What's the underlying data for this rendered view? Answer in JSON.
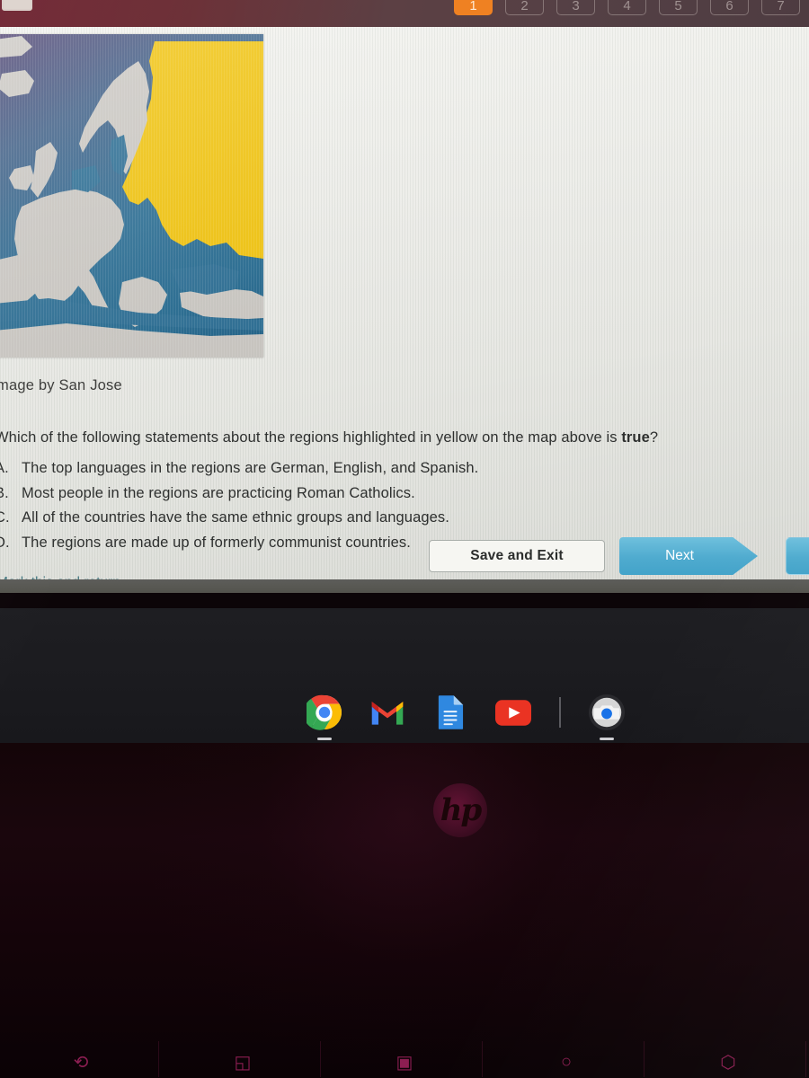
{
  "quiz_nav": {
    "buttons": [
      {
        "label": "1",
        "active": true
      },
      {
        "label": "2",
        "active": false
      },
      {
        "label": "3",
        "active": false
      },
      {
        "label": "4",
        "active": false
      },
      {
        "label": "5",
        "active": false
      },
      {
        "label": "6",
        "active": false
      },
      {
        "label": "7",
        "active": false
      }
    ],
    "active_color": "#ef8122"
  },
  "content": {
    "image_caption": "mage by San Jose",
    "question_prefix": "Which of the following statements about the regions highlighted in yellow on the map above is ",
    "question_emphasis": "true",
    "question_suffix": "?",
    "choices": [
      {
        "letter": "A.",
        "text": "The top languages in the regions are German, English, and Spanish."
      },
      {
        "letter": "B.",
        "text": "Most people in the regions are practicing Roman Catholics."
      },
      {
        "letter": "C.",
        "text": "All of the countries have the same ethnic groups and languages."
      },
      {
        "letter": "D.",
        "text": "The regions are made up of formerly communist countries."
      }
    ]
  },
  "map": {
    "alt": "Map of Europe with Eastern European regions highlighted in yellow",
    "ocean_color": "#2b6d93",
    "land_color": "#c9c6c1",
    "highlight_color": "#f0c20c"
  },
  "footer": {
    "mark_link": "Mark this and return",
    "save_button": "Save and Exit",
    "next_button": "Next",
    "next_color": "#4fabcf",
    "link_color": "#4a7f88"
  },
  "shelf": {
    "icons": [
      {
        "name": "chrome-icon",
        "label": "Google Chrome",
        "running": true
      },
      {
        "name": "gmail-icon",
        "label": "Gmail",
        "running": false
      },
      {
        "name": "google-docs-icon",
        "label": "Google Docs",
        "running": false
      },
      {
        "name": "youtube-icon",
        "label": "YouTube",
        "running": false
      },
      {
        "name": "camera-icon",
        "label": "Camera",
        "running": true
      }
    ]
  },
  "laptop": {
    "brand": "hp",
    "function_keys": [
      "⟲",
      "◱",
      "▣",
      "○",
      "⬡"
    ]
  }
}
